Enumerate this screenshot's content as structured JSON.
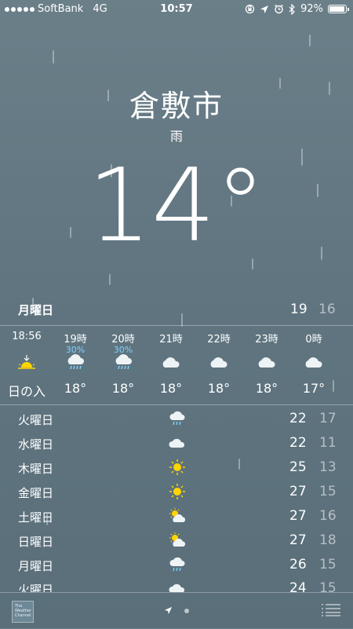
{
  "status": {
    "carrier": "SoftBank",
    "network": "4G",
    "time": "10:57",
    "battery": "92%"
  },
  "location": {
    "city": "倉敷市",
    "condition": "雨",
    "temperature": "14°"
  },
  "today": {
    "day": "月曜日",
    "high": "19",
    "low": "16"
  },
  "hourly": [
    {
      "label": "18:56",
      "prob": "",
      "icon": "sunset-icon",
      "temp": "日の入"
    },
    {
      "label": "19時",
      "prob": "30%",
      "icon": "rain-cloud-icon",
      "temp": "18°"
    },
    {
      "label": "20時",
      "prob": "30%",
      "icon": "rain-cloud-icon",
      "temp": "18°"
    },
    {
      "label": "21時",
      "prob": "",
      "icon": "cloud-icon",
      "temp": "18°"
    },
    {
      "label": "22時",
      "prob": "",
      "icon": "cloud-icon",
      "temp": "18°"
    },
    {
      "label": "23時",
      "prob": "",
      "icon": "cloud-icon",
      "temp": "18°"
    },
    {
      "label": "0時",
      "prob": "",
      "icon": "cloud-icon",
      "temp": "17°"
    }
  ],
  "daily": [
    {
      "day": "火曜日",
      "icon": "rain-cloud-icon",
      "high": "22",
      "low": "17"
    },
    {
      "day": "水曜日",
      "icon": "cloud-icon",
      "high": "22",
      "low": "11"
    },
    {
      "day": "木曜日",
      "icon": "sun-icon",
      "high": "25",
      "low": "13"
    },
    {
      "day": "金曜日",
      "icon": "sun-icon",
      "high": "27",
      "low": "15"
    },
    {
      "day": "土曜日",
      "icon": "partly-cloudy-icon",
      "high": "27",
      "low": "16"
    },
    {
      "day": "日曜日",
      "icon": "partly-cloudy-icon",
      "high": "27",
      "low": "18"
    },
    {
      "day": "月曜日",
      "icon": "rain-cloud-icon",
      "high": "26",
      "low": "15"
    },
    {
      "day": "火曜日",
      "icon": "cloud-icon",
      "high": "24",
      "low": "15"
    }
  ],
  "footer": {
    "logo_text": "The Weather Channel"
  },
  "colors": {
    "background": "#607580",
    "precip": "#7fd3ff",
    "sun": "#ffd400"
  }
}
